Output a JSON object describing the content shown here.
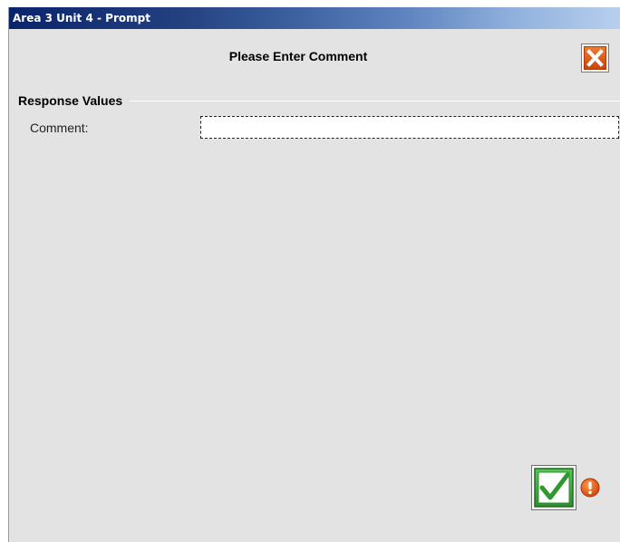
{
  "window": {
    "title": "Area 3 Unit 4 - Prompt"
  },
  "prompt": {
    "heading": "Please Enter Comment"
  },
  "response_values": {
    "group_label": "Response Values",
    "comment_label": "Comment:",
    "comment_value": "",
    "comment_placeholder": ""
  },
  "icons": {
    "close": "close-icon",
    "ok": "checkmark-icon",
    "warning": "exclamation-icon"
  },
  "colors": {
    "close_orange": "#e05a17",
    "ok_green": "#3da33d",
    "warning_orange": "#e05a17"
  }
}
